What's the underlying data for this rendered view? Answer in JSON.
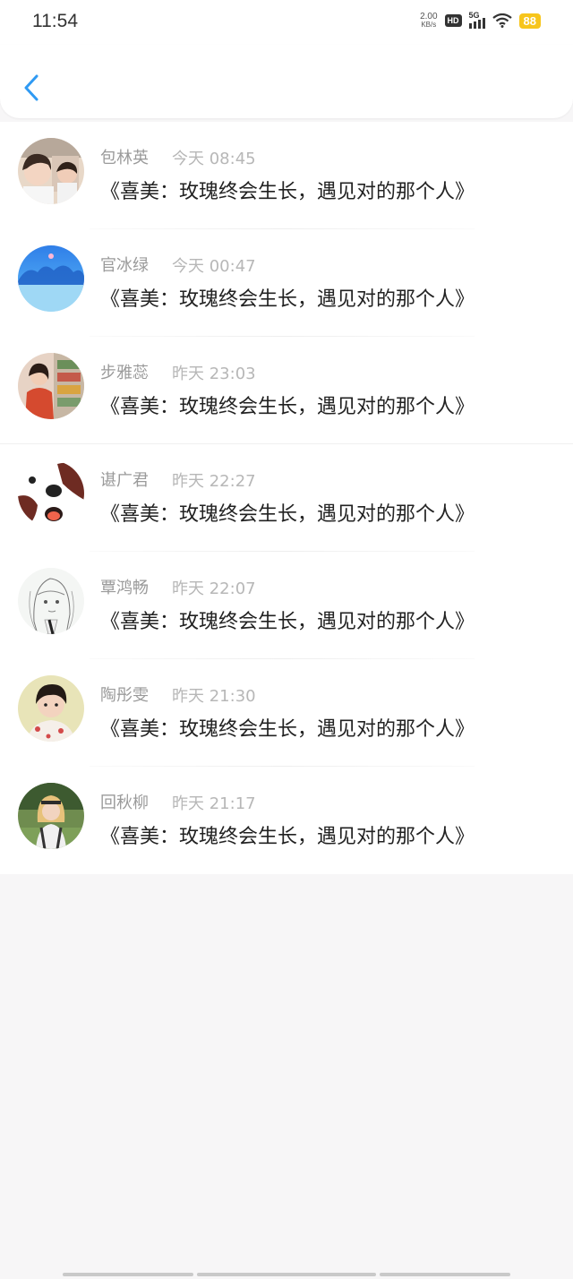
{
  "status_bar": {
    "time": "11:54",
    "net_speed": "2.00",
    "net_unit": "KB/s",
    "hd": "HD",
    "network": "5G",
    "battery": "88",
    "battery_color": "#f7c51b"
  },
  "nav": {
    "back_icon": "chevron-left-icon",
    "accent": "#2f9af3"
  },
  "messages": [
    {
      "name": "包林英",
      "time": "今天 08:45",
      "text": "《喜美：玫瑰终会生长，遇见对的那个人》"
    },
    {
      "name": "官冰绿",
      "time": "今天 00:47",
      "text": "《喜美：玫瑰终会生长，遇见对的那个人》"
    },
    {
      "name": "步雅蕊",
      "time": "昨天 23:03",
      "text": "《喜美：玫瑰终会生长，遇见对的那个人》"
    },
    {
      "name": "谌广君",
      "time": "昨天 22:27",
      "text": "《喜美：玫瑰终会生长，遇见对的那个人》"
    },
    {
      "name": "覃鸿畅",
      "time": "昨天 22:07",
      "text": "《喜美：玫瑰终会生长，遇见对的那个人》"
    },
    {
      "name": "陶彤雯",
      "time": "昨天 21:30",
      "text": "《喜美：玫瑰终会生长，遇见对的那个人》"
    },
    {
      "name": "回秋柳",
      "time": "昨天 21:17",
      "text": "《喜美：玫瑰终会生长，遇见对的那个人》"
    }
  ]
}
